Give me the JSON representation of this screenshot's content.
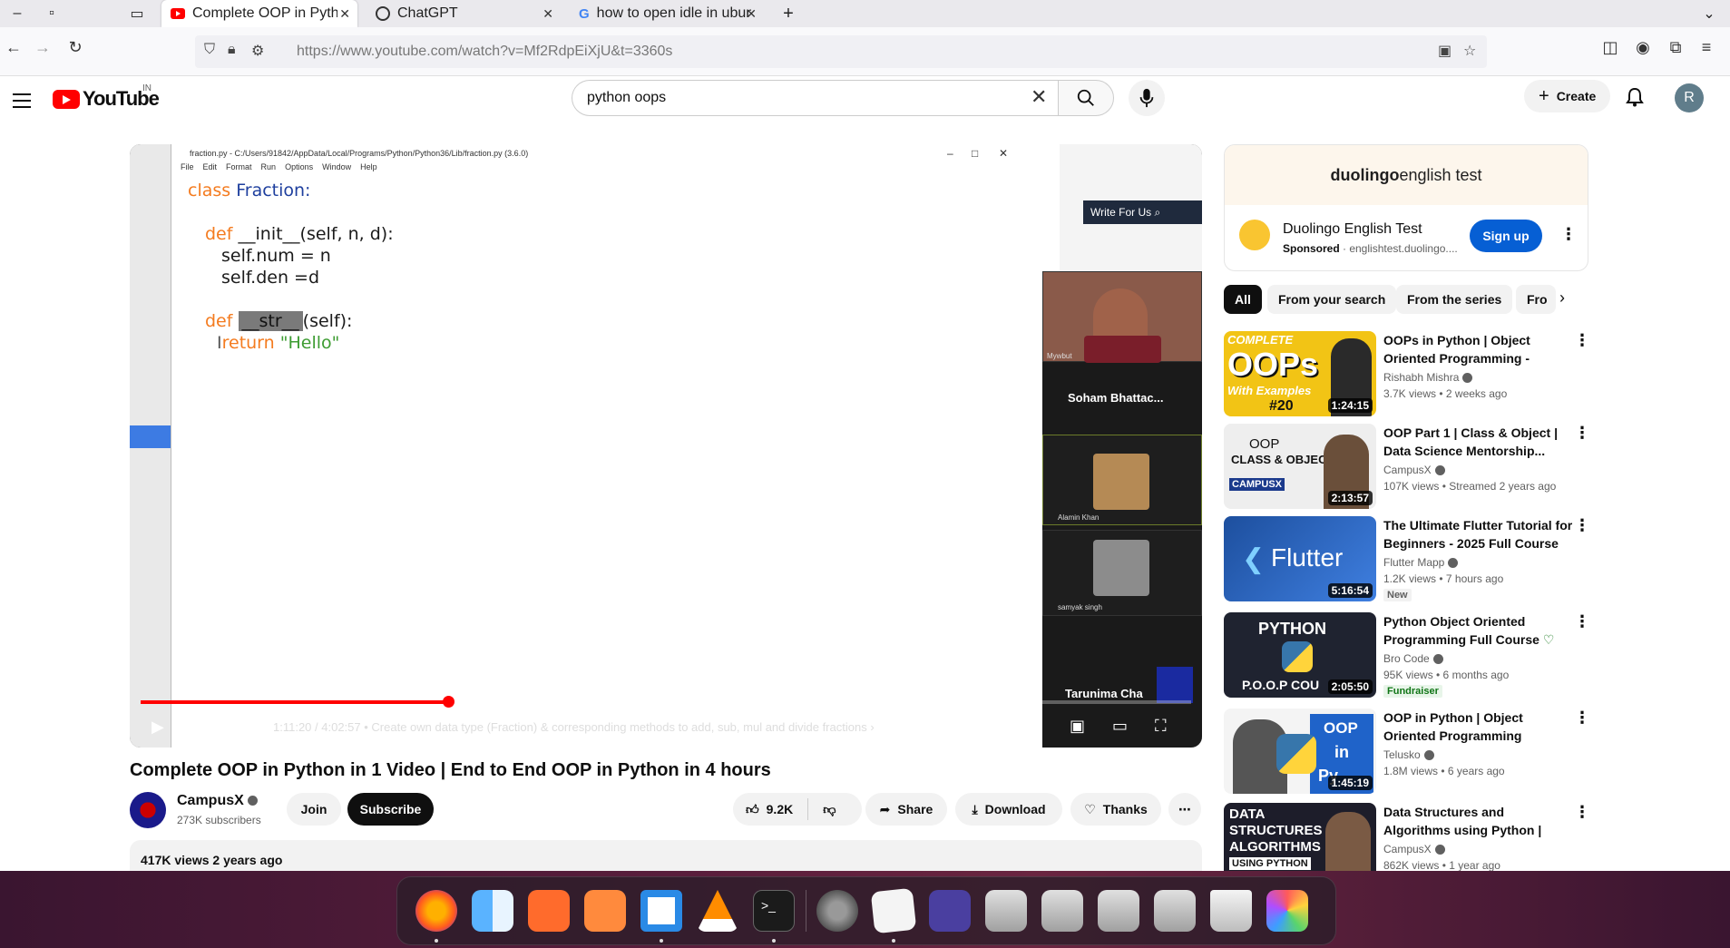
{
  "browser": {
    "tabs": [
      {
        "label": "Complete OOP in Python",
        "active": true
      },
      {
        "label": "ChatGPT",
        "active": false
      },
      {
        "label": "how to open idle in ubun",
        "active": false
      }
    ],
    "url_domain": "https://www.youtube.com",
    "url_path": "/watch?v=Mf2RdpEiXjU&t=3360s"
  },
  "yt": {
    "logo": "YouTube",
    "country": "IN",
    "search_value": "python oops",
    "create_label": "Create",
    "avatar_letter": "R"
  },
  "player": {
    "idle_title": "fraction.py - C:/Users/91842/AppData/Local/Programs/Python/Python36/Lib/fraction.py (3.6.0)",
    "idle_menu": [
      "File",
      "Edit",
      "Format",
      "Run",
      "Options",
      "Window",
      "Help"
    ],
    "code": {
      "l1_kw": "class",
      "l1_name": "Fraction:",
      "l2_kw": "def",
      "l2_rest": "__init__(self, n, d):",
      "l3": "self.num = n",
      "l4": "self.den =d",
      "l5_kw": "def",
      "l5_sel": "__str__",
      "l5_rest": "(self):",
      "l6_kw": "return",
      "l6_str": "\"Hello\""
    },
    "write_for_us": "Write For Us",
    "zoom": {
      "p1_label": "Mywbut",
      "p2_name": "Soham Bhattac...",
      "p3_label": "Alamin Khan",
      "p4_label": "samyak singh",
      "p5_name": "Tarunima Cha"
    },
    "time": "1:11:20 / 4:02:57",
    "chapter": "Create own data type (Fraction) & corresponding methods to add, sub, mul and divide fractions",
    "progress": 0.293
  },
  "video": {
    "title": "Complete OOP in Python in 1 Video | End to End OOP in Python in 4 hours",
    "channel": "CampusX",
    "subscribers": "273K subscribers",
    "join": "Join",
    "subscribe": "Subscribe",
    "likes": "9.2K",
    "share": "Share",
    "download": "Download",
    "thanks": "Thanks",
    "views": "417K views",
    "age": "2 years ago"
  },
  "ad": {
    "brand_bold": "duolingo",
    "brand_rest": " english test",
    "name": "Duolingo English Test",
    "sponsored": "Sponsored",
    "domain": " · englishtest.duolingo....",
    "cta": "Sign up"
  },
  "chips": [
    "All",
    "From your search",
    "From the series",
    "Fro"
  ],
  "recommendations": [
    {
      "title": "OOPs in Python | Object Oriented Programming - Class...",
      "channel": "Rishabh Mishra",
      "meta": "3.7K views • 2 weeks ago",
      "duration": "1:24:15",
      "badge": ""
    },
    {
      "title": "OOP Part 1 | Class & Object | Data Science Mentorship...",
      "channel": "CampusX",
      "meta": "107K views • Streamed 2 years ago",
      "duration": "2:13:57",
      "badge": ""
    },
    {
      "title": "The Ultimate Flutter Tutorial for Beginners - 2025 Full Course",
      "channel": "Flutter Mapp",
      "meta": "1.2K views • 7 hours ago",
      "duration": "5:16:54",
      "badge": "New"
    },
    {
      "title": "Python Object Oriented Programming Full Course",
      "channel": "Bro Code",
      "meta": "95K views • 6 months ago",
      "duration": "2:05:50",
      "badge": "Fundraiser"
    },
    {
      "title": "OOP in Python | Object Oriented Programming",
      "channel": "Telusko",
      "meta": "1.8M views • 6 years ago",
      "duration": "1:45:19",
      "badge": ""
    },
    {
      "title": "Data Structures and Algorithms using Python | Mega Video |...",
      "channel": "CampusX",
      "meta": "862K views • 1 year ago",
      "duration": "",
      "badge": ""
    }
  ],
  "thumb_text": {
    "t1a": "COMPLETE",
    "t1b": "OOPs",
    "t1c": "With Examples",
    "t1d": "#20",
    "t2a": "OOP",
    "t2b": "CLASS & OBJECT",
    "t2c": "CAMPUSX",
    "t3a": "Flutter",
    "t4a": "PYTHON",
    "t4b": "P.O.O.P COU",
    "t5a": "OOP",
    "t5b": "in",
    "t5c": "Py",
    "t6a": "DATA",
    "t6b": "STRUCTURES",
    "t6c": "ALGORITHMS",
    "t6d": "USING PYTHON"
  },
  "colors": {
    "accent_red": "#ff0000",
    "signup_blue": "#065fd4",
    "dock_bg": "#3a1530"
  }
}
